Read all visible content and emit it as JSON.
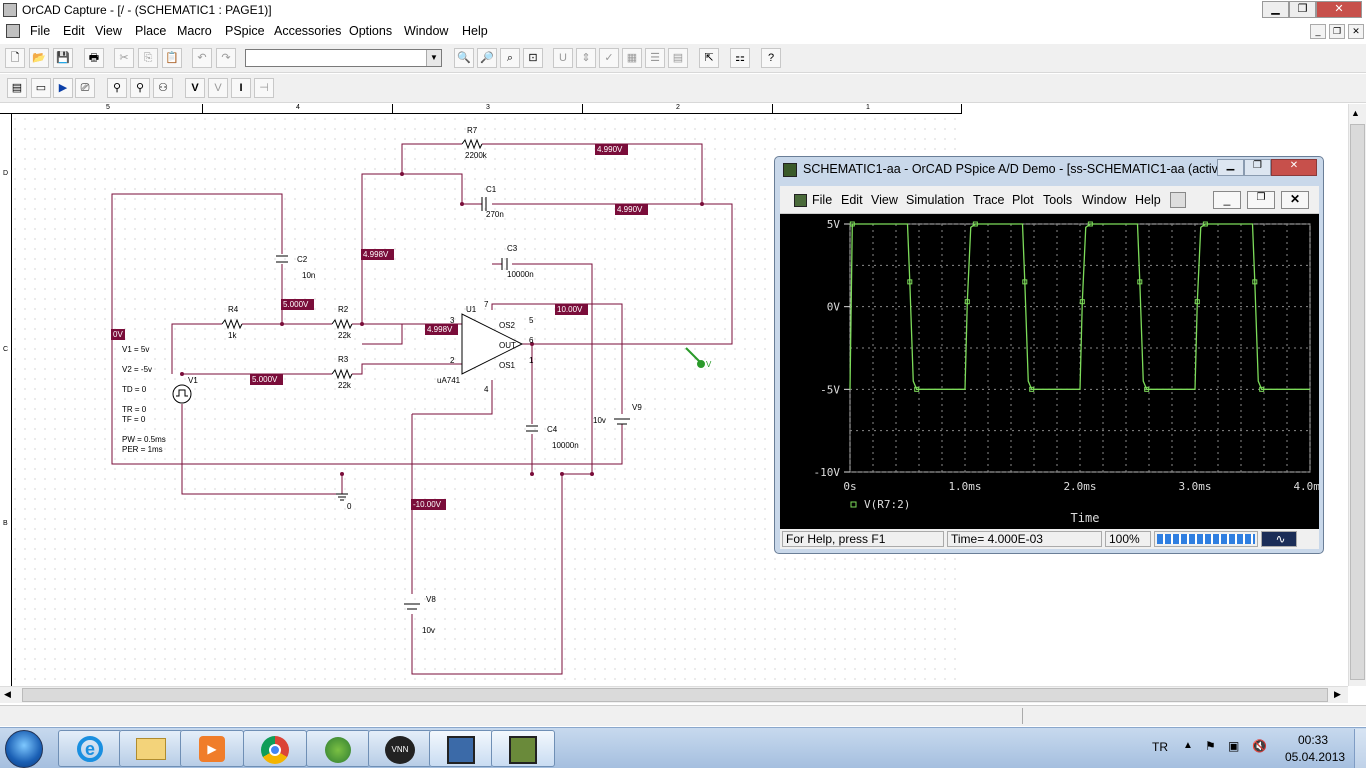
{
  "window": {
    "title": "OrCAD Capture - [/ - (SCHEMATIC1 : PAGE1)]"
  },
  "menu": [
    "File",
    "Edit",
    "View",
    "Place",
    "Macro",
    "PSpice",
    "Accessories",
    "Options",
    "Window",
    "Help"
  ],
  "ruler": {
    "top": [
      "5",
      "4",
      "3",
      "2",
      "1"
    ],
    "left": [
      "D",
      "C",
      "B"
    ]
  },
  "schematic": {
    "labels": {
      "r7": "R7",
      "r7v": "2200k",
      "c1": "C1",
      "c1v": "270n",
      "c2": "C2",
      "c2v": "10n",
      "c3": "C3",
      "c3v": "10000n",
      "c4": "C4",
      "c4v": "10000n",
      "r4": "R4",
      "r4v": "1k",
      "r2": "R2",
      "r2v": "22k",
      "r3": "R3",
      "r3v": "22k",
      "u1": "U1",
      "u1v": "uA741",
      "v1": "V1",
      "v8": "V8",
      "v8v": "10v",
      "v9": "V9",
      "v9v": "10v",
      "v1p1": "V1 = 5v",
      "v1p2": "V2 = -5v",
      "v1p3": "TD = 0",
      "v1p4": "TR = 0",
      "v1p5": "TF = 0",
      "v1p6": "PW = 0.5ms",
      "v1p7": "PER = 1ms",
      "gnd": "0",
      "probe": "V",
      "pin3": "3",
      "pin2": "2",
      "pin5": "5",
      "pin6": "6",
      "pin1": "1",
      "pin7": "7",
      "pin4": "4",
      "os2": "OS2",
      "os1": "OS1",
      "out": "OUT"
    },
    "voltages": {
      "t1": "4.990V",
      "t2": "4.990V",
      "t3": "4.998V",
      "t4": "5.000V",
      "t5": "0V",
      "t6": "4.998V",
      "t7": "10.00V",
      "t8": "5.000V",
      "t9": "-10.00V"
    }
  },
  "pspice": {
    "title": "SCHEMATIC1-aa - OrCAD PSpice A/D Demo  - [ss-SCHEMATIC1-aa (active)]",
    "menu": [
      "File",
      "Edit",
      "View",
      "Simulation",
      "Trace",
      "Plot",
      "Tools",
      "Window",
      "Help"
    ],
    "status": {
      "help": "For Help, press F1",
      "time": "Time= 4.000E-03",
      "zoom": "100%"
    },
    "plot_color": "#7ddc5a"
  },
  "chart_data": {
    "type": "line",
    "title": "",
    "xlabel": "Time",
    "ylabel": "",
    "x_ticks": [
      "0s",
      "1.0ms",
      "2.0ms",
      "3.0ms",
      "4.0ms"
    ],
    "y_ticks": [
      "5V",
      "0V",
      "-5V",
      "-10V"
    ],
    "xlim": [
      0,
      4.0
    ],
    "ylim": [
      -10,
      5
    ],
    "x_unit": "ms",
    "legend_label": "V(R7:2)",
    "series": [
      {
        "name": "V(R7:2)",
        "x": [
          0,
          0.02,
          0.5,
          0.52,
          0.55,
          0.58,
          1.0,
          1.02,
          1.05,
          1.09,
          1.5,
          1.52,
          1.55,
          1.58,
          2.0,
          2.02,
          2.05,
          2.09,
          2.5,
          2.52,
          2.55,
          2.58,
          3.0,
          3.02,
          3.05,
          3.09,
          3.5,
          3.52,
          3.55,
          3.58,
          4.0
        ],
        "values": [
          -5,
          5,
          5,
          1.5,
          -4.5,
          -5,
          -5,
          0.3,
          4.8,
          5,
          5,
          1.5,
          -4.5,
          -5,
          -5,
          0.3,
          4.8,
          5,
          5,
          1.5,
          -4.5,
          -5,
          -5,
          0.3,
          4.8,
          5,
          5,
          1.5,
          -4.5,
          -5,
          -5
        ]
      }
    ],
    "grid": true
  },
  "statusbar": {},
  "taskbar": {
    "lang": "TR",
    "time": "00:33",
    "date": "05.04.2013"
  }
}
